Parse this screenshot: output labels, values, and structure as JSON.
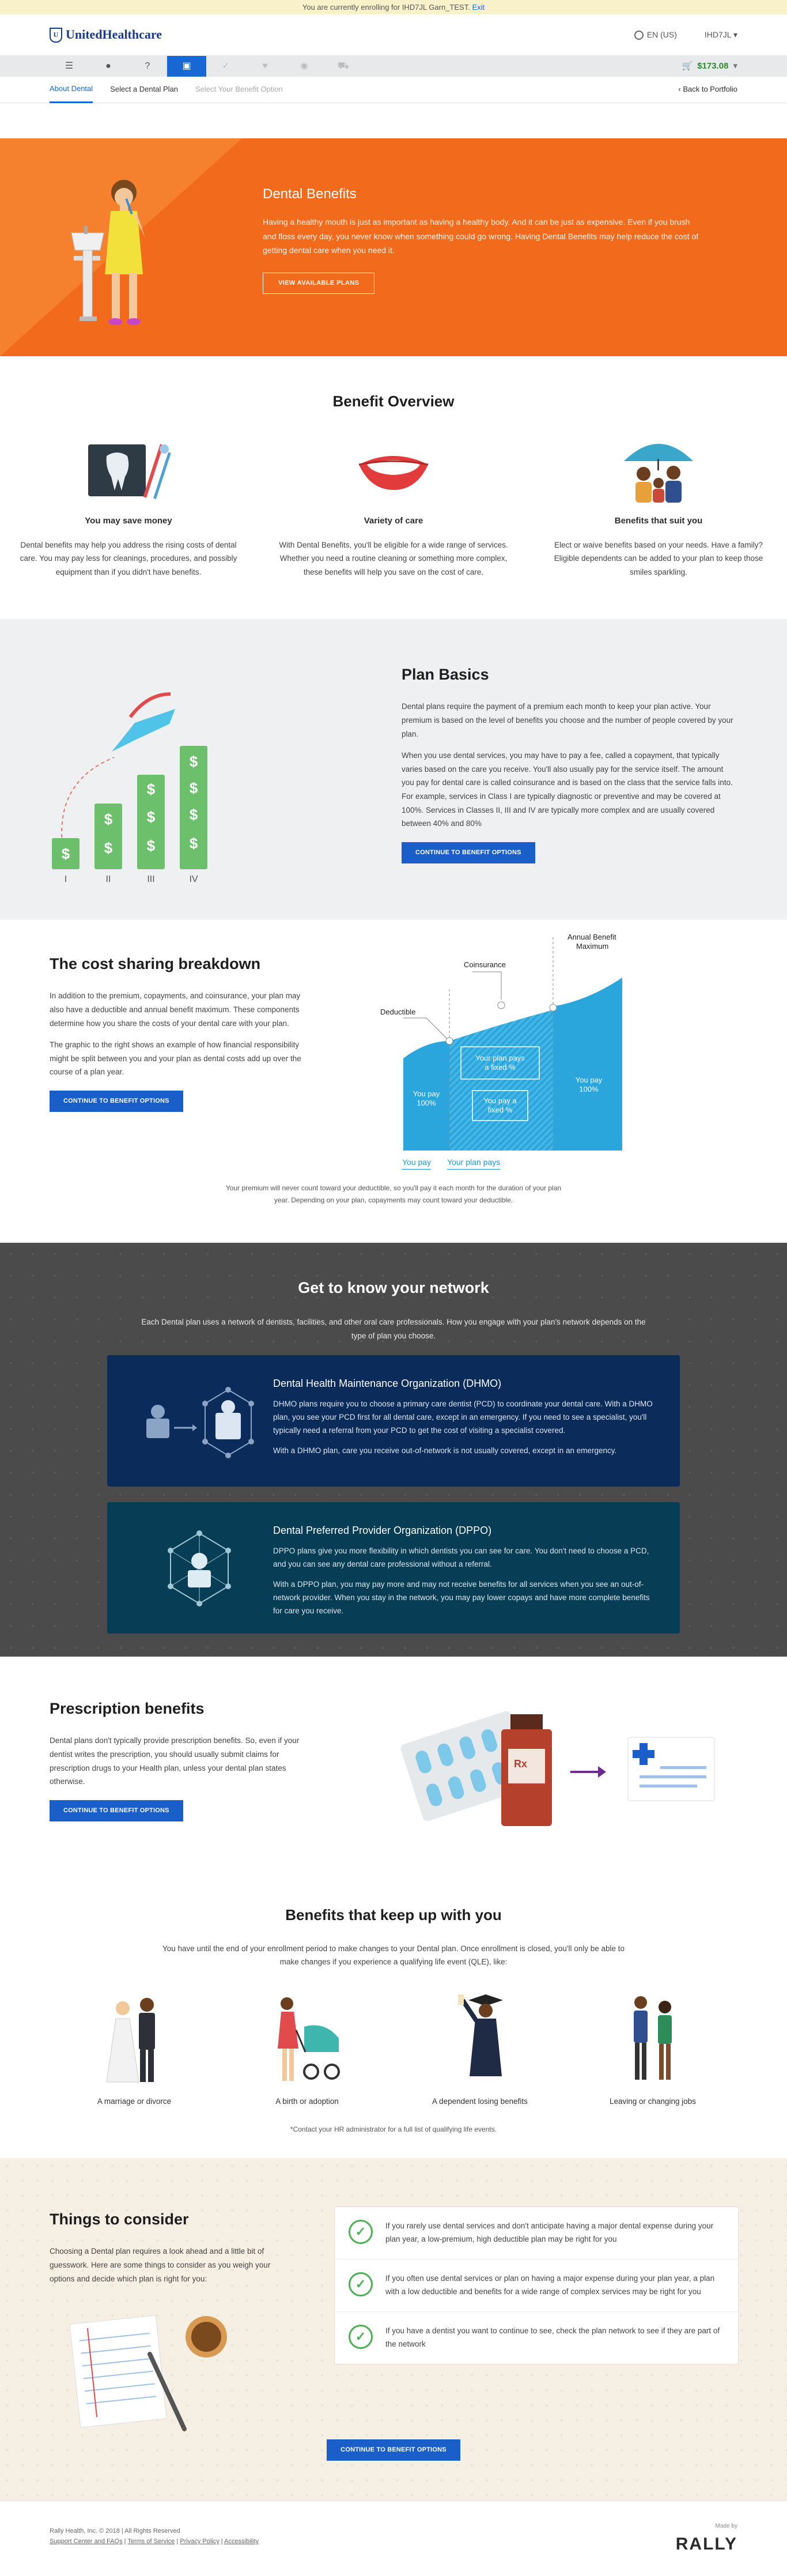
{
  "banner": {
    "text": "You are currently enrolling for IHD7JL Garn_TEST.",
    "exit_link": "Exit"
  },
  "header": {
    "logo": "UnitedHealthcare",
    "language": "EN (US)",
    "user": "IHD7JL"
  },
  "toolbar": {
    "cart_total": "$173.08",
    "icons": [
      "menu-icon",
      "person-icon",
      "help-icon",
      "dental-icon",
      "check-icon",
      "heart-icon",
      "vision-icon",
      "cart-icon"
    ]
  },
  "subnav": {
    "items": [
      "About Dental",
      "Select a Dental Plan",
      "Select Your Benefit Option"
    ],
    "back": "Back to Portfolio"
  },
  "hero": {
    "title": "Dental Benefits",
    "body": "Having a healthy mouth is just as important as having a healthy body. And it can be just as expensive. Even if you brush and floss every day, you never know when something could go wrong. Having Dental Benefits may help reduce the cost of getting dental care when you need it.",
    "button": "VIEW AVAILABLE PLANS"
  },
  "overview": {
    "title": "Benefit Overview",
    "cols": [
      {
        "heading": "You may save money",
        "body": "Dental benefits may help you address the rising costs of dental care. You may pay less for cleanings, procedures, and possibly equipment than if you didn't have benefits."
      },
      {
        "heading": "Variety of care",
        "body": "With Dental Benefits, you'll be eligible for a wide range of services. Whether you need a routine cleaning or something more complex, these benefits will help you save on the cost of care."
      },
      {
        "heading": "Benefits that suit you",
        "body": "Elect or waive benefits based on your needs. Have a family? Eligible dependents can be added to your plan to keep those smiles sparkling."
      }
    ]
  },
  "basics": {
    "title": "Plan Basics",
    "p1": "Dental plans require the payment of a premium each month to keep your plan active. Your premium is based on the level of benefits you choose and the number of people covered by your plan.",
    "p2": "When you use dental services, you may have to pay a fee, called a copayment, that typically varies based on the care you receive. You'll also usually pay for the service itself. The amount you pay for dental care is called coinsurance and is based on the class that the service falls into. For example, services in Class I are typically diagnostic or preventive and may be covered at 100%. Services in Classes II, III and IV are typically more complex and are usually covered between 40% and 80%",
    "button": "CONTINUE TO BENEFIT OPTIONS",
    "class_labels": [
      "I",
      "II",
      "III",
      "IV"
    ]
  },
  "cost": {
    "title": "The cost sharing breakdown",
    "p1": "In addition to the premium, copayments, and coinsurance, your plan may also have a deductible and annual benefit maximum. These components determine how you share the costs of your dental care with your plan.",
    "p2": "The graphic to the right shows an example of how financial responsibility might be split between you and your plan as dental costs add up over the course of a plan year.",
    "button": "CONTINUE TO BENEFIT OPTIONS",
    "diagram": {
      "deductible": "Deductible",
      "coinsurance": "Coinsurance",
      "annual_max_1": "Annual Benefit",
      "annual_max_2": "Maximum",
      "you_pay_left_1": "You pay",
      "you_pay_left_2": "100%",
      "plan_pays_1": "Your plan pays",
      "plan_pays_2": "a fixed %",
      "you_pay_mid_1": "You pay a",
      "you_pay_mid_2": "fixed %",
      "you_pay_right_1": "You pay",
      "you_pay_right_2": "100%"
    },
    "legend_you": "You pay",
    "legend_plan": "Your plan pays",
    "footnote": "Your premium will never count toward your deductible, so you'll pay it each month for the duration of your plan year. Depending on your plan, copayments may count toward your deductible."
  },
  "network": {
    "title": "Get to know your network",
    "intro": "Each Dental plan uses a network of dentists, facilities, and other oral care professionals. How you engage with your plan's network depends on the type of plan you choose.",
    "dhmo": {
      "title": "Dental Health Maintenance Organization (DHMO)",
      "p1": "DHMO plans require you to choose a primary care dentist (PCD) to coordinate your dental care. With a DHMO plan, you see your PCD first for all dental care, except in an emergency. If you need to see a specialist, you'll typically need a referral from your PCD to get the cost of visiting a specialist covered.",
      "p2": "With a DHMO plan, care you receive out-of-network is not usually covered, except in an emergency."
    },
    "dppo": {
      "title": "Dental Preferred Provider Organization (DPPO)",
      "p1": "DPPO plans give you more flexibility in which dentists you can see for care. You don't need to choose a PCD, and you can see any dental care professional without a referral.",
      "p2": "With a DPPO plan, you may pay more and may not receive benefits for all services when you see an out-of-network provider. When you stay in the network, you may pay lower copays and have more complete benefits for care you receive."
    }
  },
  "rx": {
    "title": "Prescription benefits",
    "body": "Dental plans don't typically provide prescription benefits. So, even if your dentist writes the prescription, you should usually submit claims for prescription drugs to your Health plan, unless your dental plan states otherwise.",
    "button": "CONTINUE TO BENEFIT OPTIONS"
  },
  "keepup": {
    "title": "Benefits that keep up with you",
    "intro": "You have until the end of your enrollment period to make changes to your Dental plan. Once enrollment is closed, you'll only be able to make changes if you experience a qualifying life event (QLE), like:",
    "items": [
      "A marriage or divorce",
      "A birth or adoption",
      "A dependent losing benefits",
      "Leaving or changing jobs"
    ],
    "note": "*Contact your HR administrator for a full list of qualifying life events."
  },
  "things": {
    "title": "Things to consider",
    "body": "Choosing a Dental plan requires a look ahead and a little bit of guesswork. Here are some things to consider as you weigh your options and decide which plan is right for you:",
    "checks": [
      "If you rarely use dental services and don't anticipate having a major dental expense during your plan year, a low-premium, high deductible plan may be right for you",
      "If you often use dental services or plan on having a major expense during your plan year, a plan with a low deductible and benefits for a wide range of complex services may be right for you",
      "If you have a dentist you want to continue to see, check the plan network to see if they are part of the network"
    ],
    "button": "CONTINUE TO BENEFIT OPTIONS"
  },
  "footer": {
    "copyright": "Rally Health, Inc. © 2018  |  All Rights Reserved",
    "links": [
      "Support Center and FAQs",
      "Terms of Service",
      "Privacy Policy",
      "Accessibility"
    ],
    "made_by": "Made by",
    "brand": "RALLY"
  }
}
